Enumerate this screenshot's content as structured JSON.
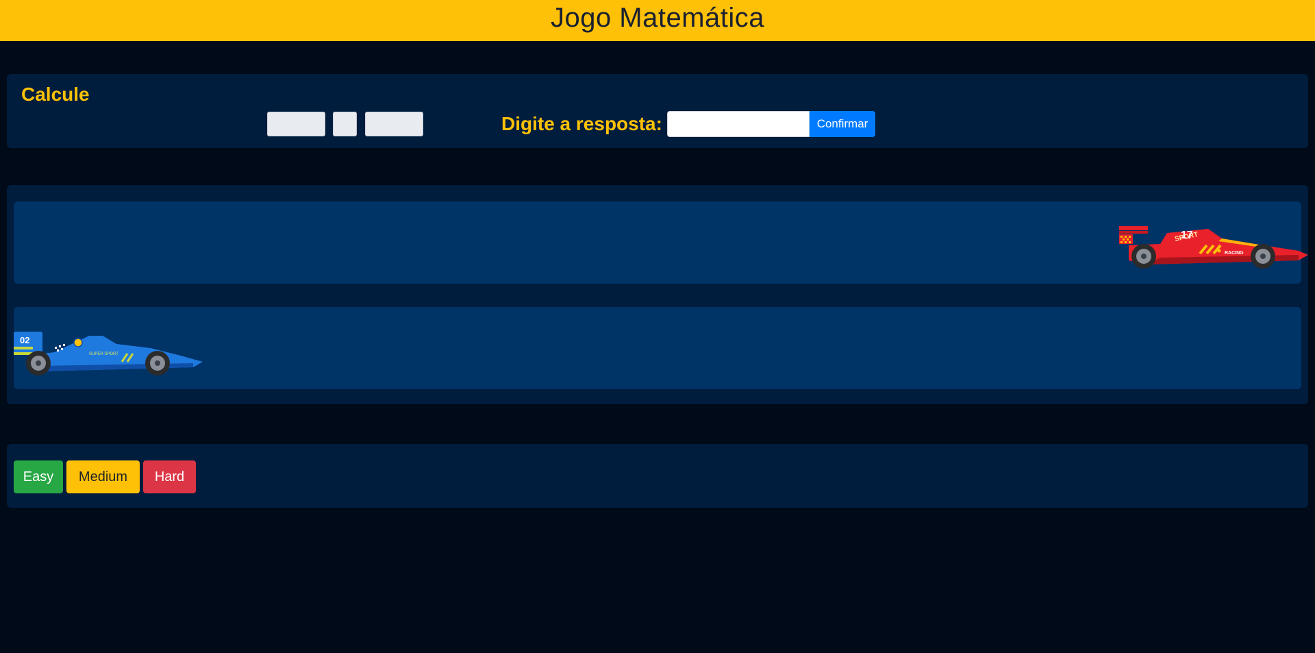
{
  "header": {
    "title": "Jogo Matemática"
  },
  "calculate": {
    "title": "Calcule",
    "operand1": "",
    "operator": "",
    "operand2": "",
    "answer_label": "Digite a resposta:",
    "answer_value": "",
    "answer_placeholder": "",
    "confirm_label": "Confirmar"
  },
  "race": {
    "player1": {
      "car_icon": "red-race-car-icon",
      "car_number": "17",
      "car_text": "SPORT",
      "car_side_text": "RACING",
      "color": "#e8212b"
    },
    "player2": {
      "car_icon": "blue-race-car-icon",
      "car_number": "02",
      "car_side_text": "SUPER SPORT",
      "color": "#1f7ae0"
    }
  },
  "levels": {
    "easy_label": "Easy",
    "medium_label": "Medium",
    "hard_label": "Hard"
  },
  "colors": {
    "accent": "#ffc107",
    "background": "#000a18",
    "panel": "#001d3d",
    "lane": "#003366",
    "confirm": "#007bff",
    "easy": "#28a745",
    "medium": "#ffc107",
    "hard": "#dc3545"
  }
}
